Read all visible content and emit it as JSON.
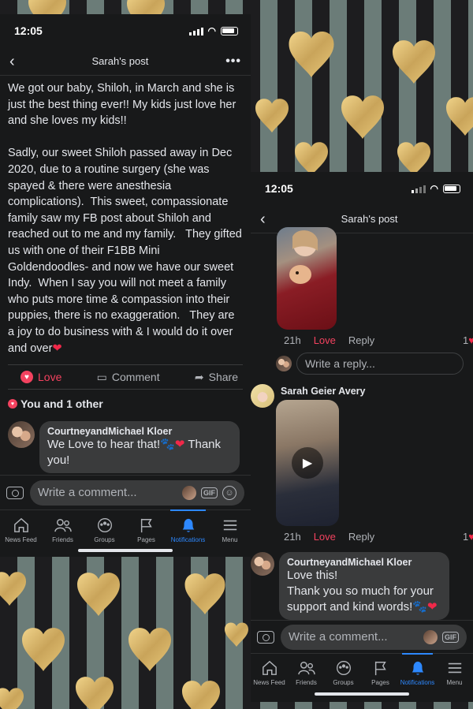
{
  "background": {
    "colors": {
      "stripe_dark": "#1d1d1f",
      "stripe_light": "#6b7c78",
      "heart_gold": "#d9b66a"
    }
  },
  "left": {
    "status": {
      "time": "12:05"
    },
    "nav": {
      "title": "Sarah's post",
      "back_icon": "chevron-left-icon",
      "more_icon": "more-horizontal-icon"
    },
    "post": {
      "text": "We got our baby, Shiloh, in March and she is just the best thing ever!! My kids just love her and she loves my kids!!\n\nSadly, our sweet Shiloh passed away in Dec 2020, due to a routine surgery (she was spayed & there were anesthesia complications).  This sweet, compassionate family saw my FB post about Shiloh and reached out to me and my family.   They gifted us with one of their F1BB Mini Goldendoodles- and now we have our sweet Indy.  When I say you will not meet a family who puts more time & compassion into their puppies, there is no exaggeration.   They are a joy to do business with & I would do it over and over"
    },
    "actions": {
      "love": "Love",
      "comment": "Comment",
      "share": "Share"
    },
    "reactions": {
      "summary": "You and 1 other"
    },
    "comment": {
      "name": "CourtneyandMichael Kloer",
      "text_before": "We Love to hear that!",
      "text_after": " Thank you!"
    },
    "composer": {
      "placeholder": "Write a comment...",
      "gif": "GIF"
    },
    "tabs": [
      {
        "label": "News Feed",
        "icon": "home-icon"
      },
      {
        "label": "Friends",
        "icon": "friends-icon"
      },
      {
        "label": "Groups",
        "icon": "groups-icon"
      },
      {
        "label": "Pages",
        "icon": "flag-icon"
      },
      {
        "label": "Notifications",
        "icon": "bell-icon",
        "active": true
      },
      {
        "label": "Menu",
        "icon": "menu-icon"
      }
    ]
  },
  "right": {
    "status": {
      "time": "12:05"
    },
    "nav": {
      "title": "Sarah's post"
    },
    "first_meta": {
      "time": "21h",
      "love": "Love",
      "reply": "Reply",
      "count": "1"
    },
    "reply_placeholder": "Write a reply...",
    "second_comment": {
      "name": "Sarah Geier Avery"
    },
    "second_meta": {
      "time": "21h",
      "love": "Love",
      "reply": "Reply",
      "count": "1"
    },
    "third_comment": {
      "name": "CourtneyandMichael Kloer",
      "line1": "Love this!",
      "line2": "Thank you so much for your",
      "line3": "support and kind words!"
    },
    "composer": {
      "placeholder": "Write a comment...",
      "gif": "GIF"
    },
    "tabs": [
      {
        "label": "News Feed"
      },
      {
        "label": "Friends"
      },
      {
        "label": "Groups"
      },
      {
        "label": "Pages"
      },
      {
        "label": "Notifications"
      },
      {
        "label": "Menu"
      }
    ]
  }
}
